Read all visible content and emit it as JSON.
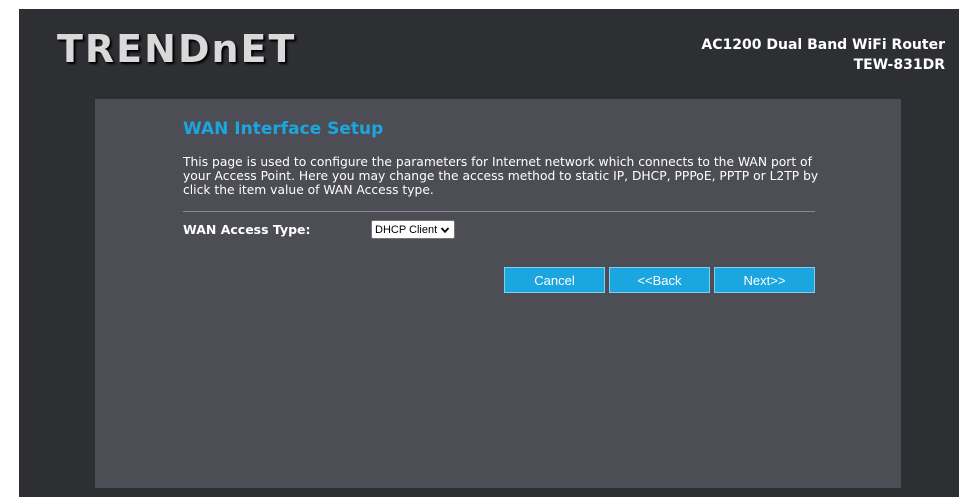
{
  "header": {
    "logo_text": "TRENDnET",
    "product_line": "AC1200 Dual Band WiFi Router",
    "model": "TEW-831DR"
  },
  "page": {
    "title": "WAN Interface Setup",
    "description": "This page is used to configure the parameters for Internet network which connects to the WAN port of your Access Point. Here you may change the access method to static IP, DHCP, PPPoE, PPTP or L2TP by click the item value of WAN Access type."
  },
  "form": {
    "wan_access_type_label": "WAN Access Type:",
    "wan_access_type_value": "DHCP Client"
  },
  "buttons": {
    "cancel": "Cancel",
    "back": "<<Back",
    "next": "Next>>"
  },
  "colors": {
    "background": "#2e2f33",
    "panel": "#4c4d55",
    "accent": "#1ca6e0",
    "text": "#ffffff"
  }
}
